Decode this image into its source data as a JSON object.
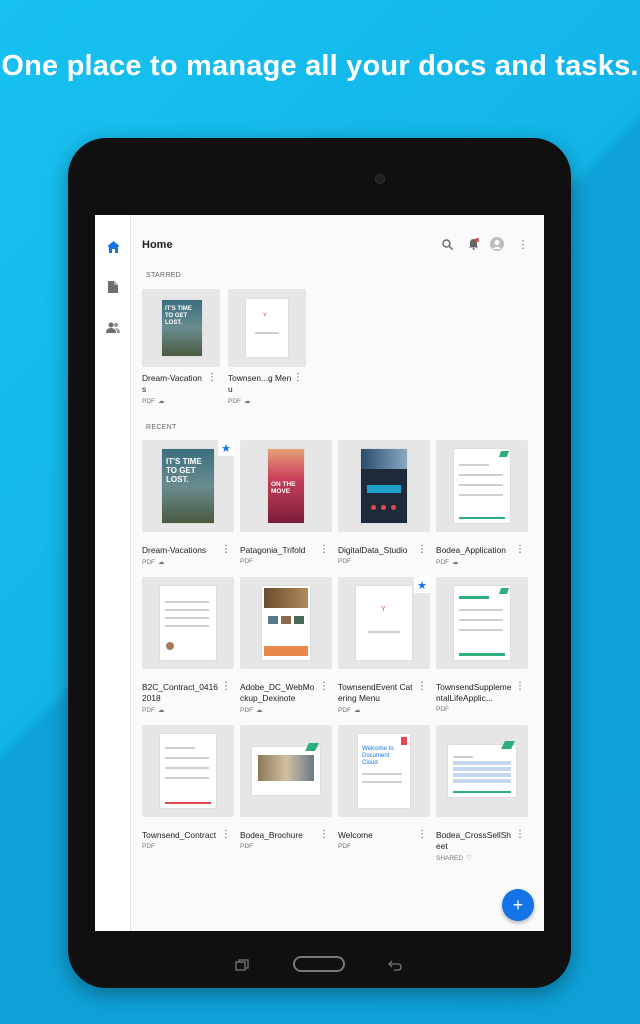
{
  "headline": "One place to manage all your docs and tasks.",
  "app": {
    "title": "Home",
    "nav": [
      {
        "name": "home",
        "icon": "home-icon"
      },
      {
        "name": "documents",
        "icon": "document-icon"
      },
      {
        "name": "shared",
        "icon": "people-icon"
      }
    ],
    "toolbar_icons": [
      "search-icon",
      "bell-icon",
      "avatar-icon",
      "more-vertical-icon"
    ]
  },
  "starred": {
    "label": "STARRED",
    "items": [
      {
        "title": "Dream-Vacations",
        "meta": "PDF"
      },
      {
        "title": "Townsen...g Menu",
        "meta": "PDF"
      }
    ]
  },
  "recent": {
    "label": "RECENT",
    "items": [
      {
        "title": "Dream-Vacations",
        "meta": "PDF",
        "starred": true
      },
      {
        "title": "Patagonia_Trifold",
        "meta": "PDF"
      },
      {
        "title": "DigitalData_Studio",
        "meta": "PDF"
      },
      {
        "title": "Bodea_Application",
        "meta": "PDF"
      },
      {
        "title": "B2C_Contract_04162018",
        "meta": "PDF"
      },
      {
        "title": "Adobe_DC_WebMockup_Dexinote",
        "meta": "PDF"
      },
      {
        "title": "TownsendEvent Catering Menu",
        "meta": "PDF",
        "starred": true
      },
      {
        "title": "TownsendSupplementalLifeApplic...",
        "meta": "PDF"
      },
      {
        "title": "Townsend_Contract",
        "meta": "PDF"
      },
      {
        "title": "Bodea_Brochure",
        "meta": "PDF"
      },
      {
        "title": "Welcome",
        "meta": "PDF"
      },
      {
        "title": "Bodea_CrossSellSheet",
        "meta": "SHARED"
      }
    ]
  },
  "thumb_text": {
    "vacation": "IT'S TIME TO GET LOST.",
    "patagonia": "ON THE MOVE",
    "welcome": "Welcome to Document Cloud"
  },
  "fab_label": "+",
  "colors": {
    "background": "#13b3e6",
    "accent": "#1473e6",
    "tablet": "#101010"
  }
}
